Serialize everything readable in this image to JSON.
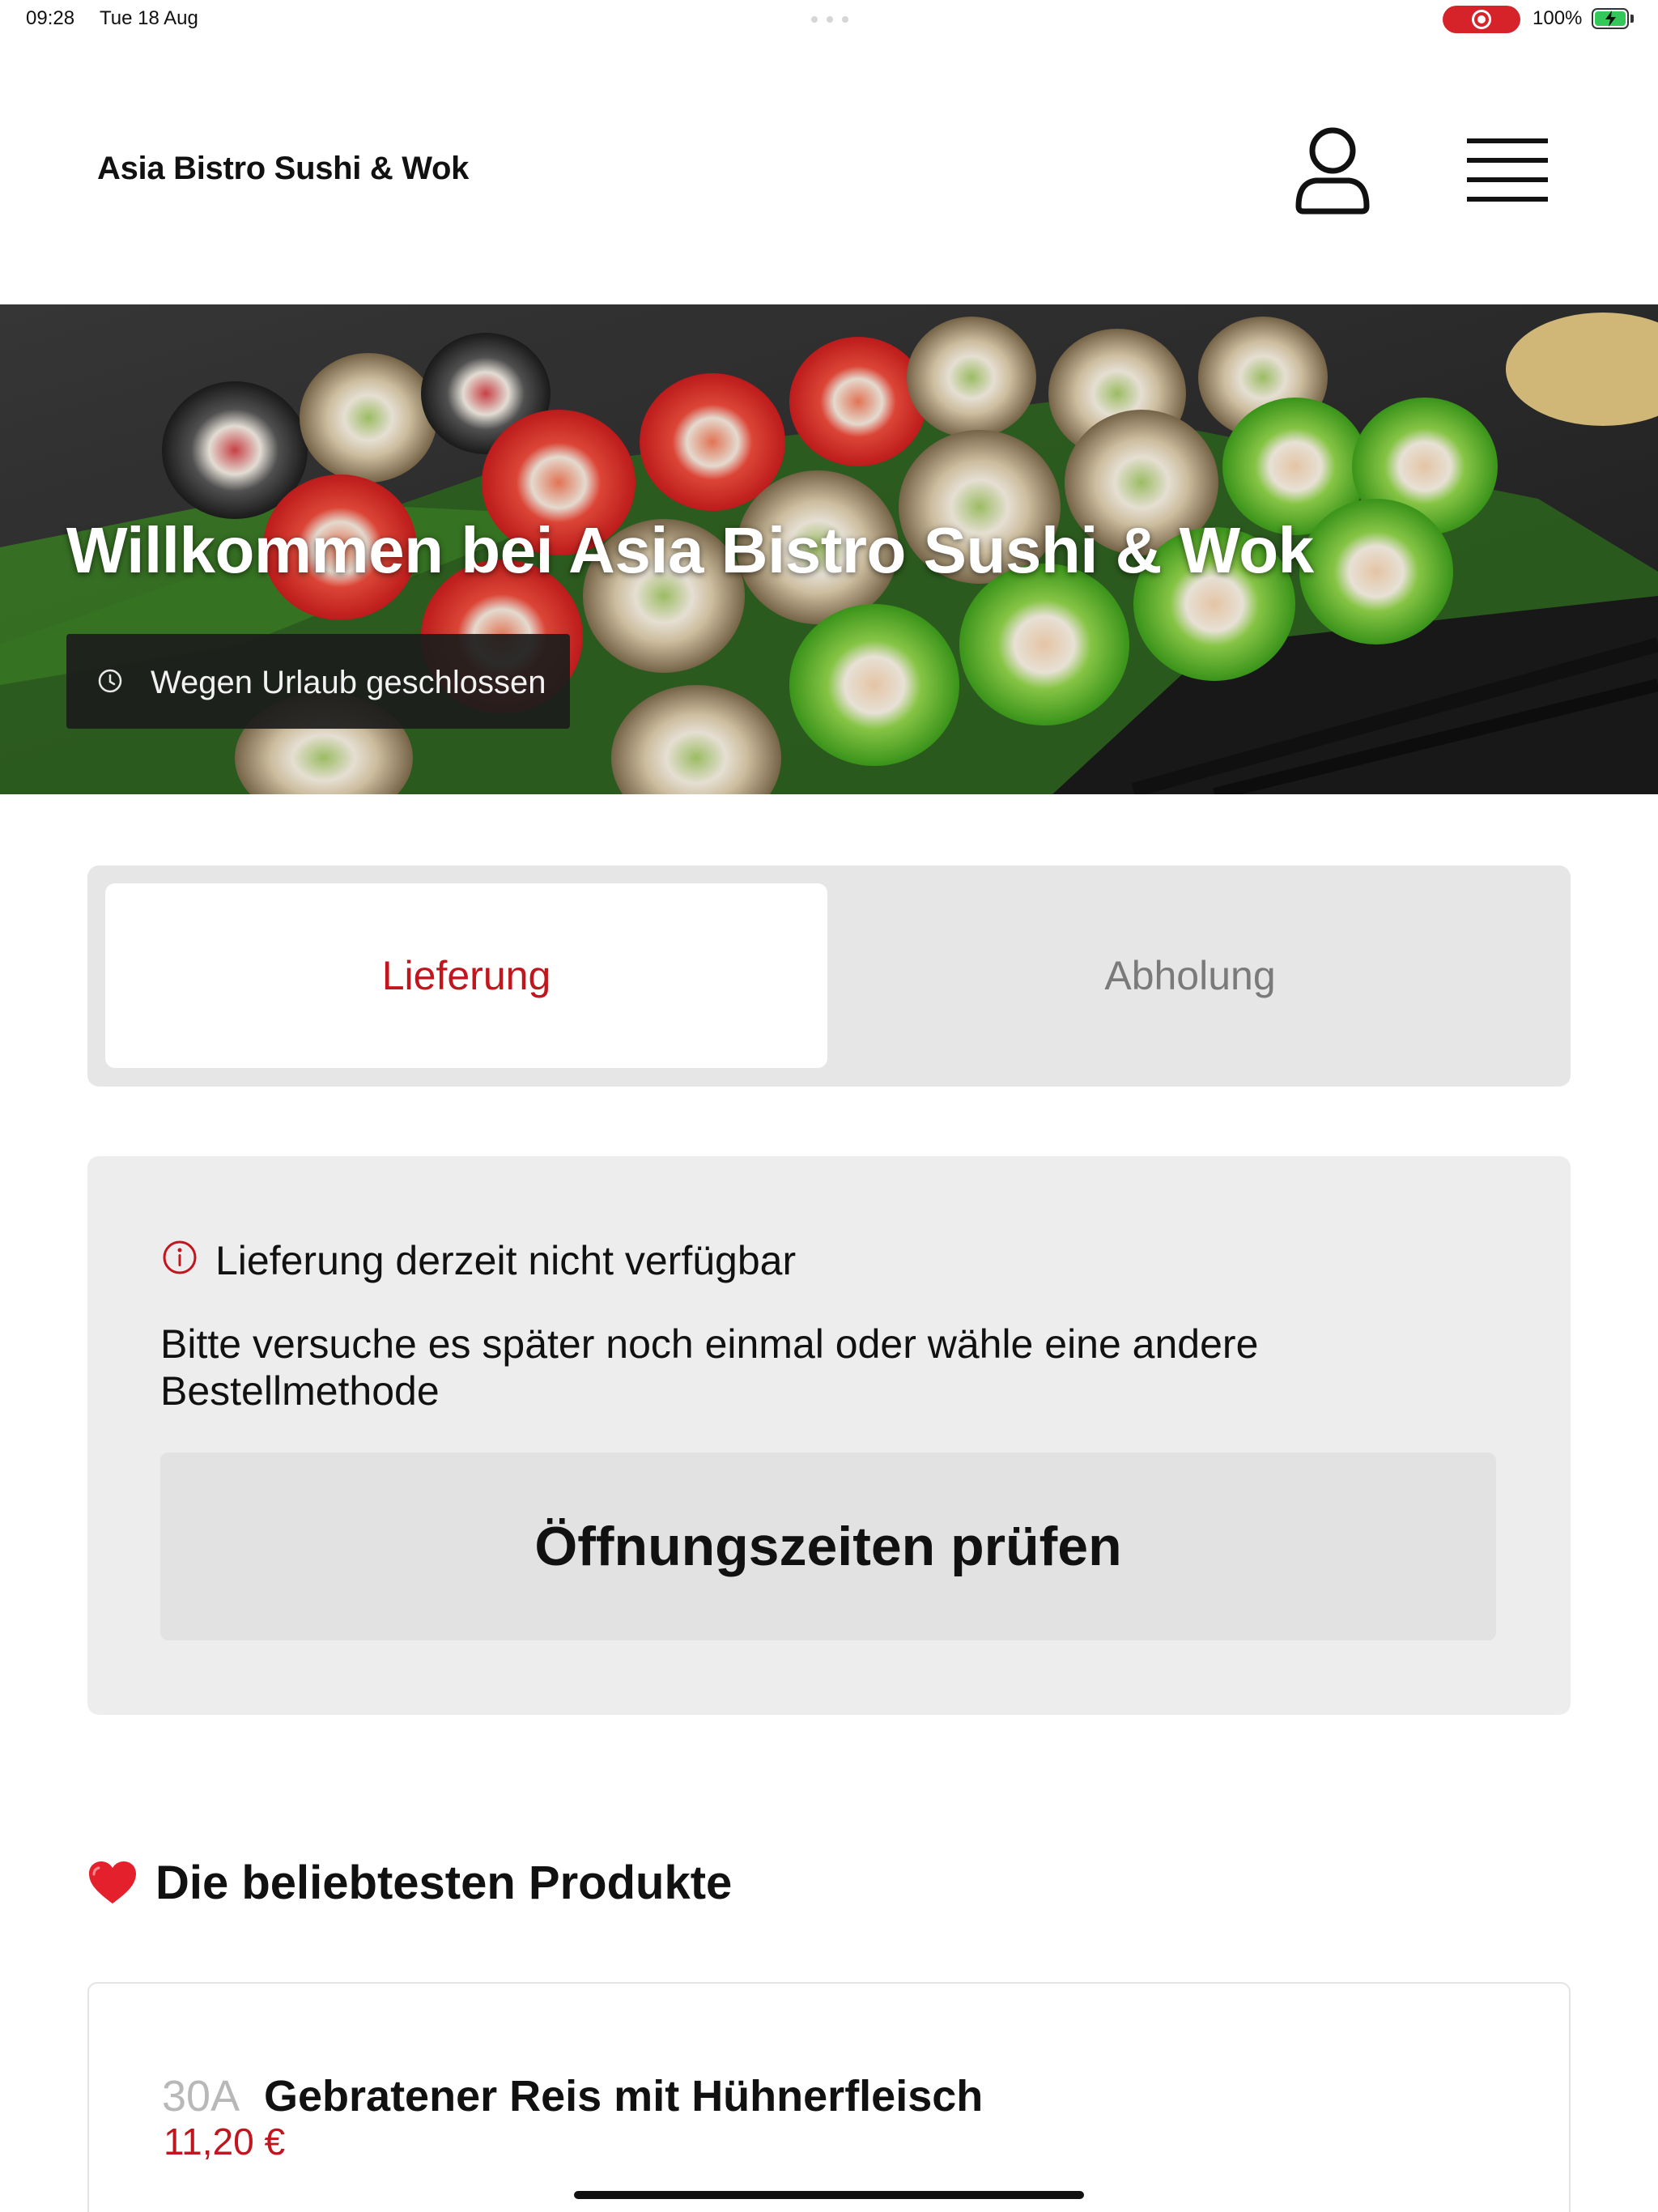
{
  "status_bar": {
    "time": "09:28",
    "date": "Tue 18 Aug",
    "battery_label": "100%",
    "record_color": "#d6232a",
    "battery_color": "#34c759"
  },
  "header": {
    "brand": "Asia Bistro Sushi & Wok",
    "account_icon": "person-icon",
    "menu_icon": "hamburger-menu-icon"
  },
  "hero": {
    "title": "Willkommen bei Asia Bistro Sushi & Wok",
    "status_badge": "Wegen Urlaub geschlossen",
    "badge_icon": "clock-icon"
  },
  "order_methods": {
    "delivery_label": "Lieferung",
    "pickup_label": "Abholung",
    "selected": "Lieferung"
  },
  "notice": {
    "icon": "info-icon",
    "title": "Lieferung derzeit nicht verfügbar",
    "text": "Bitte versuche es später noch einmal oder wähle eine andere Bestellmethode",
    "button_label": "Öffnungszeiten prüfen"
  },
  "popular": {
    "icon": "heart-icon",
    "title": "Die beliebtesten Produkte",
    "products": [
      {
        "number": "30A",
        "name": "Gebratener Reis mit Hühnerfleisch",
        "price": "11,20 €"
      }
    ]
  },
  "colors": {
    "accent": "#c0161d",
    "inactive_text": "#7a7a7a",
    "panel_bg": "#ededed",
    "toggle_bg": "#e6e6e6"
  }
}
